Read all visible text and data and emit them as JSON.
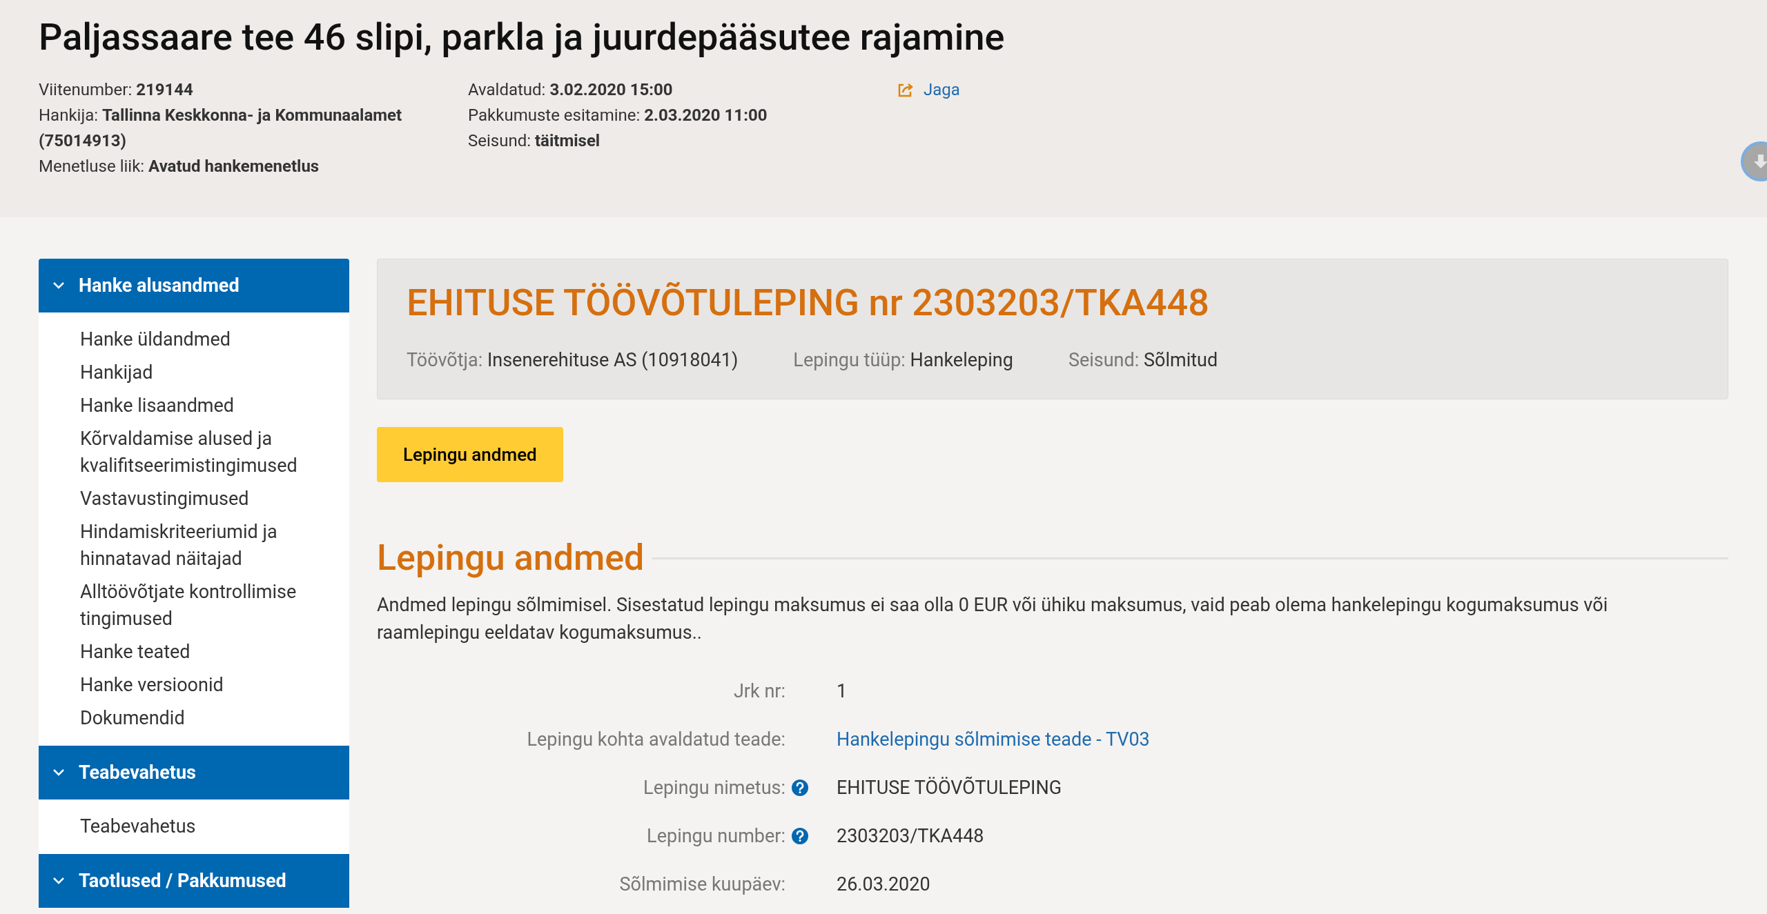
{
  "header": {
    "title": "Paljassaare tee 46 slipi, parkla ja juurdepääsutee rajamine",
    "meta_left": [
      {
        "label": "Viitenumber:",
        "value": "219144"
      },
      {
        "label": "Hankija:",
        "value": "Tallinna Keskkonna- ja Kommunaalamet (75014913)"
      },
      {
        "label": "Menetluse liik:",
        "value": "Avatud hankemenetlus"
      }
    ],
    "meta_right": [
      {
        "label": "Avaldatud:",
        "value": "3.02.2020 15:00"
      },
      {
        "label": "Pakkumuste esitamine:",
        "value": "2.03.2020 11:00"
      },
      {
        "label": "Seisund:",
        "value": "täitmisel"
      }
    ],
    "share": "Jaga"
  },
  "sidebar": {
    "sections": [
      {
        "title": "Hanke alusandmed",
        "expanded": true,
        "items": [
          "Hanke üldandmed",
          "Hankijad",
          "Hanke lisaandmed",
          "Kõrvaldamise alused ja kvalifitseerimistingimused",
          "Vastavustingimused",
          "Hindamiskriteeriumid ja hinnatavad näitajad",
          "Alltöövõtjate kontrollimise tingimused",
          "Hanke teated",
          "Hanke versioonid",
          "Dokumendid"
        ]
      },
      {
        "title": "Teabevahetus",
        "expanded": true,
        "items": [
          "Teabevahetus"
        ]
      },
      {
        "title": "Taotlused / Pakkumused",
        "expanded": true
      }
    ]
  },
  "contract": {
    "title": "EHITUSE TÖÖVÕTULEPING nr 2303203/TKA448",
    "meta": [
      {
        "label": "Töövõtja:",
        "value": "Insenerehituse AS (10918041)"
      },
      {
        "label": "Lepingu tüüp:",
        "value": "Hankeleping"
      },
      {
        "label": "Seisund:",
        "value": "Sõlmitud"
      }
    ]
  },
  "tab_button": "Lepingu andmed",
  "section": {
    "heading": "Lepingu andmed",
    "description": "Andmed lepingu sõlmimisel. Sisestatud lepingu maksumus ei saa olla 0 EUR või ühiku maksumus, vaid peab olema hankelepingu kogumaksumus või raamlepingu eeldatav kogumaksumus..",
    "fields": [
      {
        "label": "Jrk nr:",
        "value": "1",
        "kind": "text",
        "help": false
      },
      {
        "label": "Lepingu kohta avaldatud teade:",
        "value": "Hankelepingu sõlmimise teade - TV03",
        "kind": "link",
        "help": false
      },
      {
        "label": "Lepingu nimetus:",
        "value": "EHITUSE TÖÖVÕTULEPING",
        "kind": "text",
        "help": true
      },
      {
        "label": "Lepingu number:",
        "value": "2303203/TKA448",
        "kind": "text",
        "help": true
      },
      {
        "label": "Sõlmimise kuupäev:",
        "value": "26.03.2020",
        "kind": "text",
        "help": false
      }
    ]
  }
}
